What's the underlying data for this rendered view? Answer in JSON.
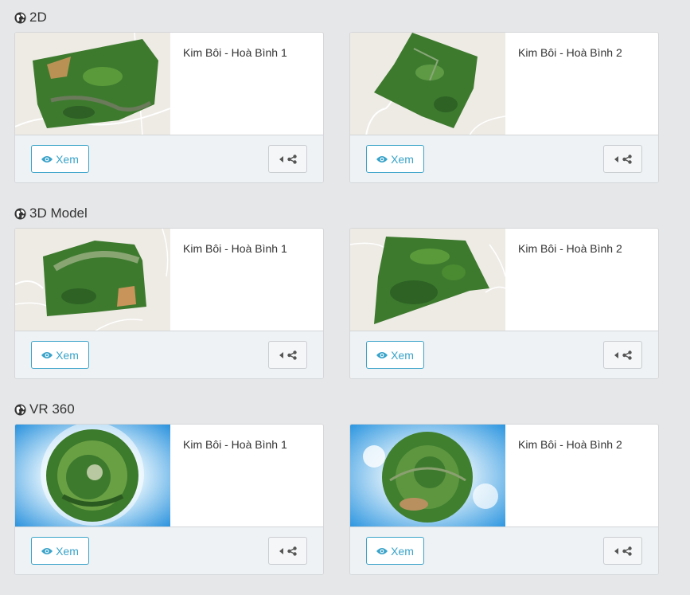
{
  "sections": [
    {
      "title": "2D",
      "cards": [
        {
          "name": "Kim Bôi - Hoà Bình 1",
          "view_label": "Xem"
        },
        {
          "name": "Kim Bôi - Hoà Bình 2",
          "view_label": "Xem"
        }
      ]
    },
    {
      "title": "3D Model",
      "cards": [
        {
          "name": "Kim Bôi - Hoà Bình 1",
          "view_label": "Xem"
        },
        {
          "name": "Kim Bôi - Hoà Bình 2",
          "view_label": "Xem"
        }
      ]
    },
    {
      "title": "VR 360",
      "cards": [
        {
          "name": "Kim Bôi - Hoà Bình 1",
          "view_label": "Xem"
        },
        {
          "name": "Kim Bôi - Hoà Bình 2",
          "view_label": "Xem"
        }
      ]
    }
  ],
  "icons": {
    "section": "globe-icon",
    "view": "eye-icon",
    "share_caret": "caret-left-icon",
    "share": "share-icon"
  },
  "colors": {
    "accent": "#3aa3c9",
    "background": "#e6e7e9",
    "card_footer": "#eef2f5",
    "foliage": "#3d7a2e",
    "sky": "#3a9ee0"
  }
}
